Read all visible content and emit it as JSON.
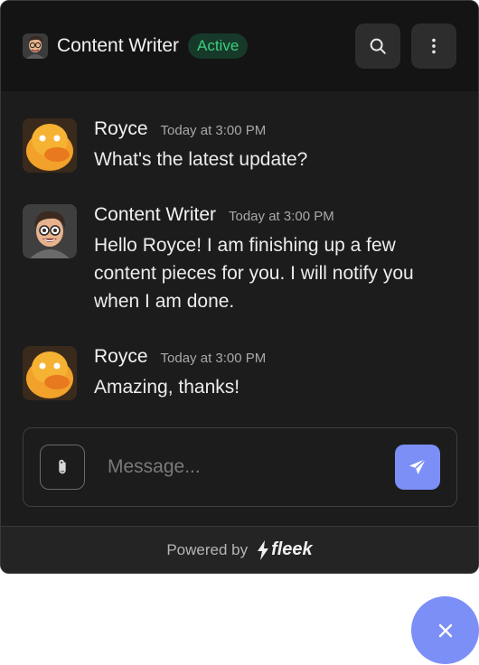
{
  "header": {
    "title": "Content Writer",
    "status": "Active",
    "avatar_icon": "cartoon-writer-avatar",
    "actions": [
      {
        "icon": "search-icon"
      },
      {
        "icon": "more-vertical-icon"
      }
    ]
  },
  "messages": [
    {
      "sender": "Royce",
      "time": "Today at 3:00 PM",
      "text": "What's the latest update?",
      "avatar": "duck-avatar"
    },
    {
      "sender": "Content Writer",
      "time": "Today at 3:00 PM",
      "text": "Hello Royce! I am finishing up a few content pieces for you. I will notify you when I am done.",
      "avatar": "cartoon-writer-avatar"
    },
    {
      "sender": "Royce",
      "time": "Today at 3:00 PM",
      "text": "Amazing, thanks!",
      "avatar": "duck-avatar"
    }
  ],
  "composer": {
    "placeholder": "Message...",
    "value": "",
    "attach_icon": "paperclip-icon",
    "send_icon": "send-icon"
  },
  "footer": {
    "powered_label": "Powered by",
    "brand_name": "fleek"
  },
  "fab": {
    "icon": "close-icon"
  },
  "colors": {
    "accent": "#7b8ff7",
    "status_green": "#3ccf7d",
    "panel_bg": "#1c1c1c",
    "header_bg": "#141414"
  }
}
